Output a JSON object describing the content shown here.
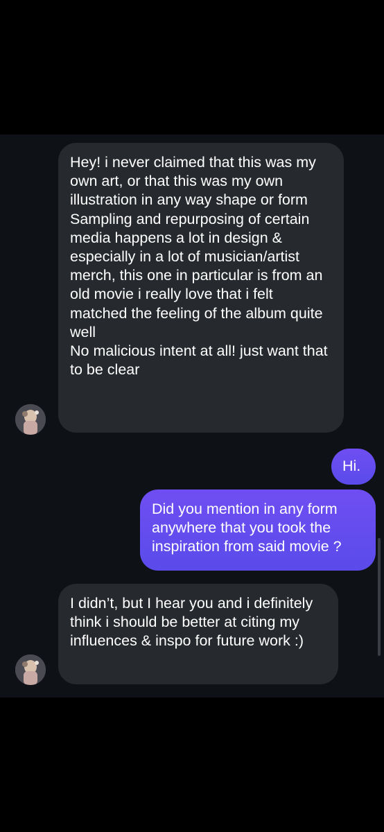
{
  "conversation": {
    "messages": [
      {
        "direction": "incoming",
        "text": "Hey! i never claimed that this was my own art, or that this was my own illustration in any way shape or form\nSampling and repurposing of certain media happens a lot in design & especially in a lot of musician/artist merch, this one in particular is from an old movie i really love that i felt matched the feeling of the album quite well\nNo malicious intent at all! just want that to be clear"
      },
      {
        "direction": "outgoing",
        "text": "Hi."
      },
      {
        "direction": "outgoing",
        "text": "Did you mention in any form anywhere that you took the inspiration from said movie ?"
      },
      {
        "direction": "incoming",
        "text": "I didn’t, but I hear you and i definitely think i should be better at citing my influences & inspo for future work :)"
      }
    ]
  },
  "colors": {
    "screen_background": "#000000",
    "chat_background": "#0e1116",
    "incoming_bubble": "#26292e",
    "outgoing_bubble": "#5f4cf0",
    "text": "#ffffff"
  },
  "icons": {
    "avatar": "user-avatar-photo"
  }
}
